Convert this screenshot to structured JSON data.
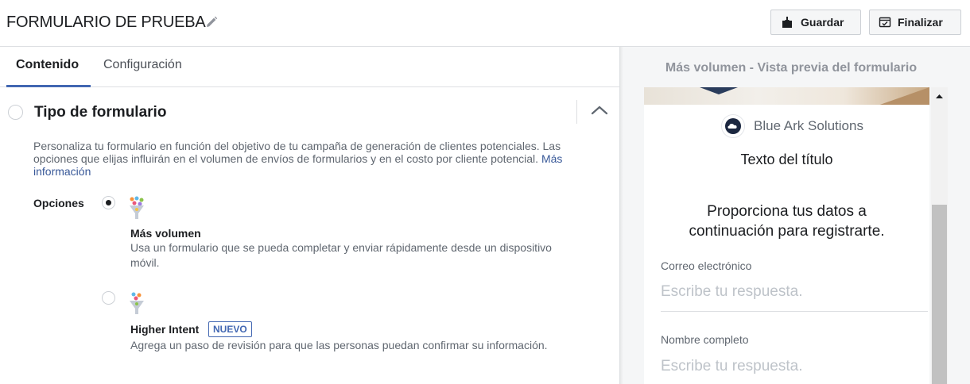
{
  "header": {
    "form_title": "FORMULARIO DE PRUEBA",
    "save_label": "Guardar",
    "finish_label": "Finalizar"
  },
  "tabs": [
    {
      "label": "Contenido",
      "active": true
    },
    {
      "label": "Configuración",
      "active": false
    }
  ],
  "section": {
    "title": "Tipo de formulario",
    "description": "Personaliza tu formulario en función del objetivo de tu campaña de generación de clientes potenciales. Las opciones que elijas influirán en el volumen de envíos de formularios y en el costo por cliente potencial.",
    "more_info_link": "Más información",
    "options_label": "Opciones",
    "options": [
      {
        "name": "Más volumen",
        "description": "Usa un formulario que se pueda completar y enviar rápidamente desde un dispositivo móvil.",
        "selected": true,
        "icon": "funnel-icon"
      },
      {
        "name": "Higher Intent",
        "badge": "NUEVO",
        "description": "Agrega un paso de revisión para que las personas puedan confirmar su información.",
        "selected": false,
        "icon": "funnel-icon"
      }
    ]
  },
  "preview": {
    "title": "Más volumen - Vista previa del formulario",
    "company": "Blue Ark Solutions",
    "form_heading": "Texto del título",
    "intro": "Proporciona tus datos a continuación para registrarte.",
    "fields": [
      {
        "label": "Correo electrónico",
        "placeholder": "Escribe tu respuesta."
      },
      {
        "label": "Nombre completo",
        "placeholder": "Escribe tu respuesta."
      }
    ]
  },
  "colors": {
    "accent": "#4267b2",
    "link": "#385898",
    "text_secondary": "#606770"
  }
}
